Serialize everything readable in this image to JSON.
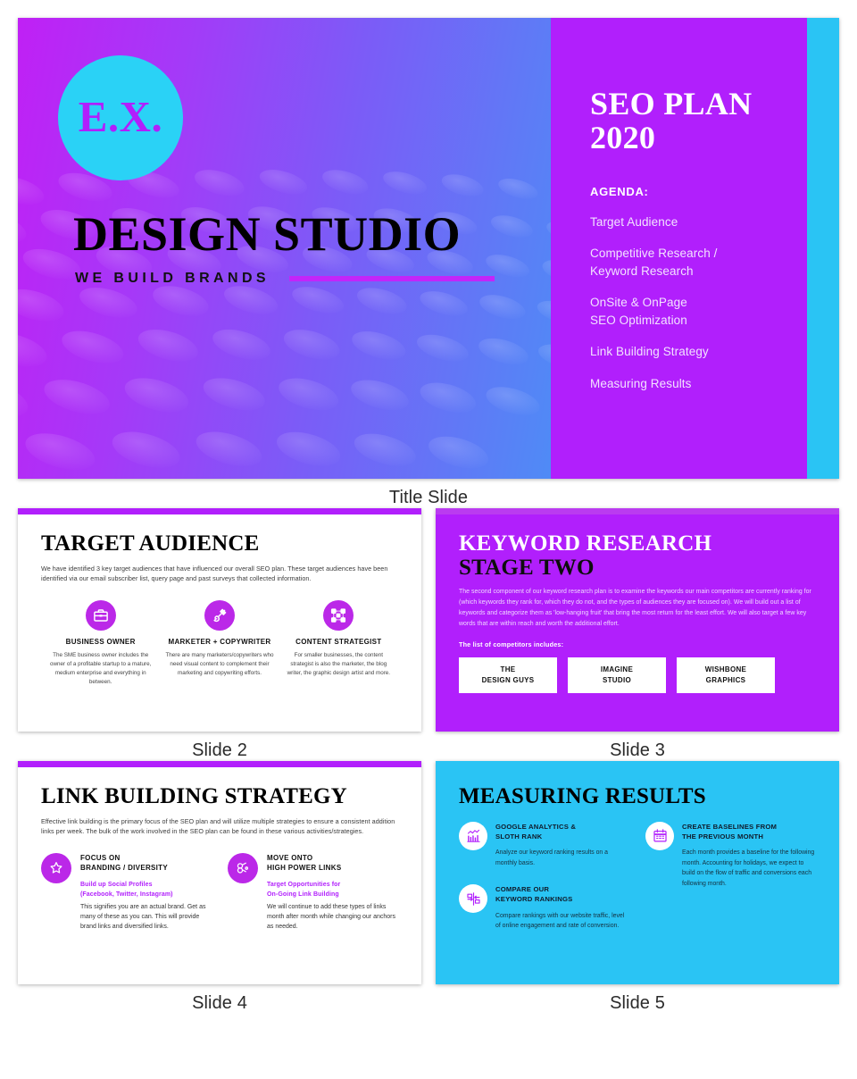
{
  "colors": {
    "purple": "#b11ffc",
    "cyan": "#2ac4f4",
    "magenta": "#bb28e8",
    "black": "#000000"
  },
  "title_slide": {
    "caption": "Title Slide",
    "logo_text": "E.X.",
    "brand": "DESIGN STUDIO",
    "tagline": "WE BUILD BRANDS",
    "heading_line1": "SEO PLAN",
    "heading_line2": "2020",
    "agenda_label": "AGENDA:",
    "agenda": [
      "Target Audience",
      "Competitive Research /\nKeyword Research",
      "OnSite & OnPage\nSEO Optimization",
      "Link Building Strategy",
      "Measuring Results"
    ]
  },
  "slide2": {
    "caption": "Slide 2",
    "title": "TARGET AUDIENCE",
    "paragraph": "We have identified 3 key target audiences that have influenced our overall SEO plan. These target audiences have been identified via our email subscriber list, query page and past surveys that collected information.",
    "columns": [
      {
        "icon": "briefcase-icon",
        "title": "BUSINESS OWNER",
        "desc": "The SME business owner includes the owner of a profitable startup to a mature, medium enterprise and everything in between."
      },
      {
        "icon": "paintbrush-icon",
        "title": "MARKETER + COPYWRITER",
        "desc": "There are many marketers/copywriters who need visual content to complement their marketing and copywriting efforts."
      },
      {
        "icon": "sitemap-icon",
        "title": "CONTENT STRATEGIST",
        "desc": "For smaller businesses, the content strategist is also the marketer, the blog writer, the graphic design artist and more."
      }
    ]
  },
  "slide3": {
    "caption": "Slide 3",
    "title_line1": "KEYWORD RESEARCH",
    "title_line2": "STAGE TWO",
    "paragraph": "The second component of our keyword research plan is to examine the keywords our main competitors are currently ranking for (which keywords they rank for, which they do not, and the types of audiences they are focused on). We will build out a list of keywords and categorize them as 'low-hanging fruit' that bring the most return for the least effort. We will also target a few key words that are within reach and worth the additional effort.",
    "subhead": "The list of competitors includes:",
    "competitors": [
      {
        "line1": "THE",
        "line2": "DESIGN GUYS"
      },
      {
        "line1": "IMAGINE",
        "line2": "STUDIO"
      },
      {
        "line1": "WISHBONE",
        "line2": "GRAPHICS"
      }
    ]
  },
  "slide4": {
    "caption": "Slide 4",
    "title": "LINK BUILDING STRATEGY",
    "paragraph": "Effective link building is the primary focus of the SEO plan and will utilize multiple strategies to ensure a consistent addition links per week. The bulk of the work involved in the SEO plan can be found in these various activities/strategies.",
    "columns": [
      {
        "icon": "star-badge-icon",
        "title": "FOCUS ON\nBRANDING / DIVERSITY",
        "highlight": "Build up Social Profiles\n(Facebook, Twitter, Instagram)",
        "desc": "This signifies you are an actual brand. Get as many of these as you can. This will provide brand links and diversified links."
      },
      {
        "icon": "chain-link-icon",
        "title": "MOVE ONTO\nHIGH POWER LINKS",
        "highlight": "Target Opportunities for\nOn-Going Link Building",
        "desc": "We will continue to add these types of links month after month while changing our anchors as needed."
      }
    ]
  },
  "slide5": {
    "caption": "Slide 5",
    "title": "MEASURING RESULTS",
    "left_items": [
      {
        "icon": "bar-chart-trend-icon",
        "title": "GOOGLE ANALYTICS &\nSLOTH RANK",
        "desc": "Analyze our keyword ranking results on a monthly basis."
      },
      {
        "icon": "compare-arrows-icon",
        "title": "COMPARE OUR\nKEYWORD RANKINGS",
        "desc": "Compare rankings with our website traffic, level of online engagement and rate of conversion."
      }
    ],
    "right_items": [
      {
        "icon": "calendar-icon",
        "title": "CREATE BASELINES FROM\nTHE PREVIOUS MONTH",
        "desc": "Each month provides a baseline for the following month. Accounting for holidays, we expect to build on the flow of traffic and conversions each following month."
      }
    ]
  }
}
